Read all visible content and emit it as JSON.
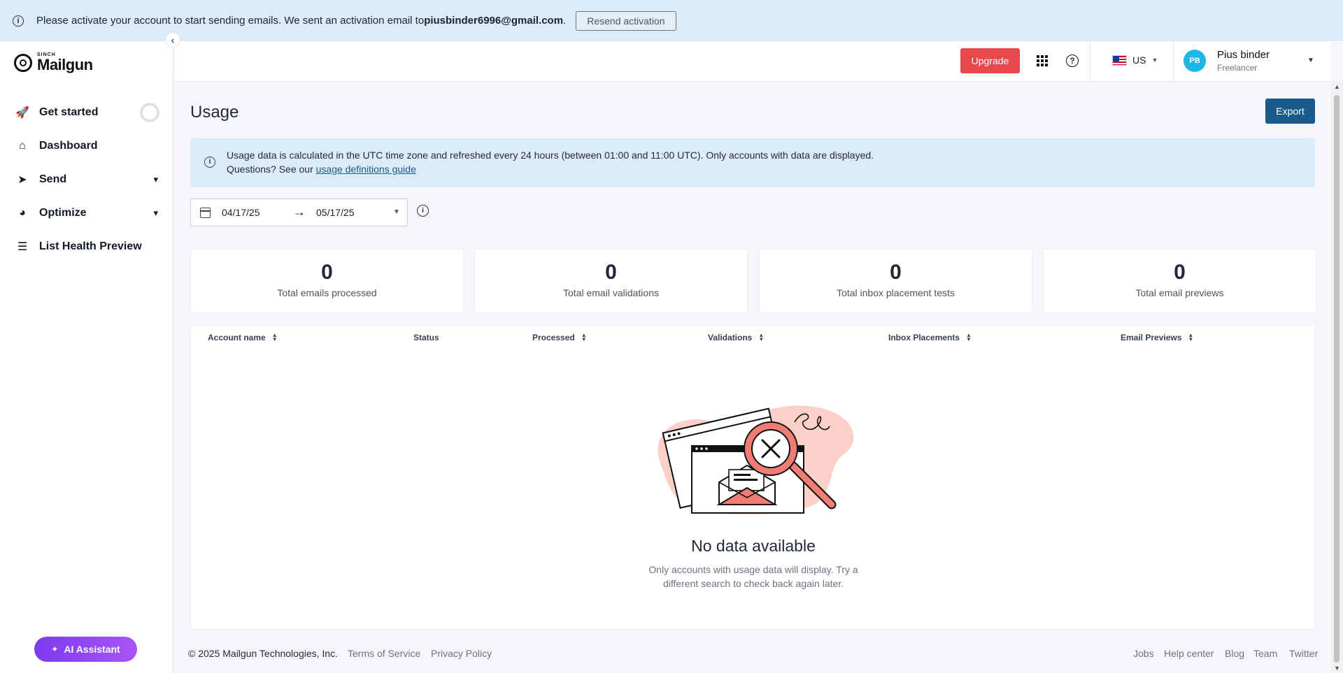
{
  "banner": {
    "text": "Please activate your account to start sending emails. We sent an activation email to ",
    "email": "piusbinder6996@gmail.com",
    "suffix": ".",
    "resend_label": "Resend activation"
  },
  "sidebar": {
    "logo_sinch": "SINCH",
    "logo_name": "Mailgun",
    "items": [
      {
        "label": "Get started"
      },
      {
        "label": "Dashboard"
      },
      {
        "label": "Send"
      },
      {
        "label": "Optimize"
      },
      {
        "label": "List Health Preview"
      }
    ],
    "ai_label": "AI Assistant"
  },
  "header": {
    "upgrade_label": "Upgrade",
    "region": "US",
    "avatar_initials": "PB",
    "user_name": "Pius binder",
    "user_role": "Freelancer"
  },
  "main": {
    "title": "Usage",
    "export_label": "Export",
    "info_line1": "Usage data is calculated in the UTC time zone and refreshed every 24 hours (between 01:00 and 11:00 UTC). Only accounts with data are displayed.",
    "info_line2_prefix": "Questions? See our ",
    "info_link": "usage definitions guide",
    "date_start": "04/17/25",
    "date_end": "05/17/25",
    "stats": [
      {
        "value": "0",
        "label": "Total emails processed"
      },
      {
        "value": "0",
        "label": "Total email validations"
      },
      {
        "value": "0",
        "label": "Total inbox placement tests"
      },
      {
        "value": "0",
        "label": "Total email previews"
      }
    ],
    "columns": [
      "Account name",
      "Status",
      "Processed",
      "Validations",
      "Inbox Placements",
      "Email Previews"
    ],
    "empty_title": "No data available",
    "empty_desc_1": "Only accounts with usage data will display. Try a",
    "empty_desc_2": "different search to check back again later."
  },
  "footer": {
    "copyright": "© 2025 Mailgun Technologies, Inc.",
    "terms": "Terms of Service",
    "privacy": "Privacy Policy",
    "links": [
      "Jobs",
      "Help center",
      "Blog",
      "Team",
      "Twitter"
    ]
  },
  "colors": {
    "upgrade": "#e8474e",
    "export": "#1a5a8a",
    "info_bg": "#dcebf8",
    "avatar": "#1fb6e7",
    "ai_gradient_start": "#7c3aed"
  }
}
